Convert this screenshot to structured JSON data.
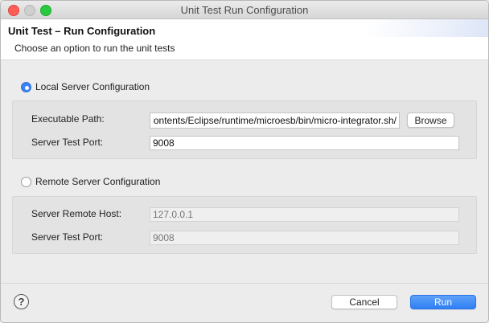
{
  "window": {
    "title": "Unit Test Run Configuration"
  },
  "banner": {
    "title": "Unit Test – Run Configuration",
    "subtitle": "Choose an option to run the unit tests"
  },
  "local": {
    "label": "Local Server Configuration",
    "selected": true,
    "executable_path_label": "Executable Path:",
    "executable_path_value": "/Applications/Eclipse.app/Contents/Eclipse/runtime/microesb/bin/micro-integrator.sh",
    "browse_label": "Browse",
    "test_port_label": "Server Test Port:",
    "test_port_value": "9008"
  },
  "remote": {
    "label": "Remote Server Configuration",
    "selected": false,
    "host_label": "Server Remote Host:",
    "host_placeholder": "127.0.0.1",
    "test_port_label": "Server Test Port:",
    "test_port_placeholder": "9008"
  },
  "footer": {
    "help_glyph": "?",
    "cancel_label": "Cancel",
    "run_label": "Run"
  },
  "colors": {
    "accent": "#3a82f7",
    "close": "#fd5f57",
    "maximize": "#29c940"
  }
}
